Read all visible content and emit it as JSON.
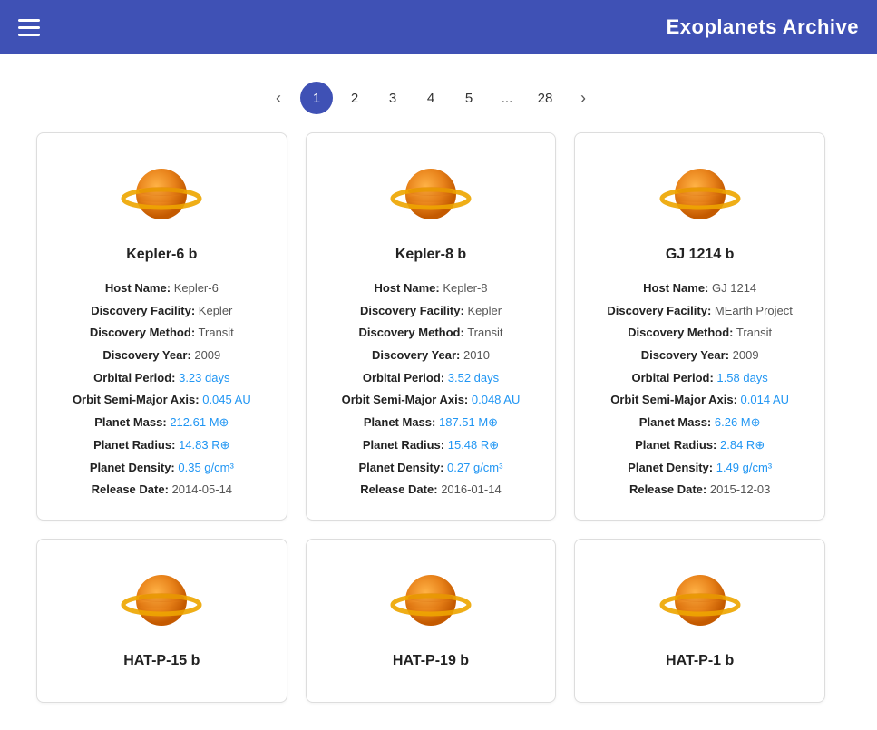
{
  "header": {
    "title": "Exoplanets Archive",
    "menu_icon_label": "Menu"
  },
  "pagination": {
    "prev_label": "‹",
    "next_label": "›",
    "pages": [
      "1",
      "2",
      "3",
      "4",
      "5",
      "...",
      "28"
    ],
    "active_page": "1"
  },
  "cards": [
    {
      "name": "Kepler-6 b",
      "host_name": "Kepler-6",
      "discovery_facility": "Kepler",
      "discovery_method": "Transit",
      "discovery_year": "2009",
      "orbital_period": "3.23 days",
      "semi_major_axis": "0.045 AU",
      "planet_mass": "212.61 M⊕",
      "planet_radius": "14.83 R⊕",
      "planet_density": "0.35 g/cm³",
      "release_date": "2014-05-14"
    },
    {
      "name": "Kepler-8 b",
      "host_name": "Kepler-8",
      "discovery_facility": "Kepler",
      "discovery_method": "Transit",
      "discovery_year": "2010",
      "orbital_period": "3.52 days",
      "semi_major_axis": "0.048 AU",
      "planet_mass": "187.51 M⊕",
      "planet_radius": "15.48 R⊕",
      "planet_density": "0.27 g/cm³",
      "release_date": "2016-01-14"
    },
    {
      "name": "GJ 1214 b",
      "host_name": "GJ 1214",
      "discovery_facility": "MEarth Project",
      "discovery_method": "Transit",
      "discovery_year": "2009",
      "orbital_period": "1.58 days",
      "semi_major_axis": "0.014 AU",
      "planet_mass": "6.26 M⊕",
      "planet_radius": "2.84 R⊕",
      "planet_density": "1.49 g/cm³",
      "release_date": "2015-12-03"
    },
    {
      "name": "HAT-P-15 b",
      "host_name": "",
      "discovery_facility": "",
      "discovery_method": "",
      "discovery_year": "",
      "orbital_period": "",
      "semi_major_axis": "",
      "planet_mass": "",
      "planet_radius": "",
      "planet_density": "",
      "release_date": ""
    },
    {
      "name": "HAT-P-19 b",
      "host_name": "",
      "discovery_facility": "",
      "discovery_method": "",
      "discovery_year": "",
      "orbital_period": "",
      "semi_major_axis": "",
      "planet_mass": "",
      "planet_radius": "",
      "planet_density": "",
      "release_date": ""
    },
    {
      "name": "HAT-P-1 b",
      "host_name": "",
      "discovery_facility": "",
      "discovery_method": "",
      "discovery_year": "",
      "orbital_period": "",
      "semi_major_axis": "",
      "planet_mass": "",
      "planet_radius": "",
      "planet_density": "",
      "release_date": ""
    }
  ],
  "labels": {
    "host_name": "Host Name:",
    "discovery_facility": "Discovery Facility:",
    "discovery_method": "Discovery Method:",
    "discovery_year": "Discovery Year:",
    "orbital_period": "Orbital Period:",
    "semi_major_axis": "Orbit Semi-Major Axis:",
    "planet_mass": "Planet Mass:",
    "planet_radius": "Planet Radius:",
    "planet_density": "Planet Density:",
    "release_date": "Release Date:"
  }
}
